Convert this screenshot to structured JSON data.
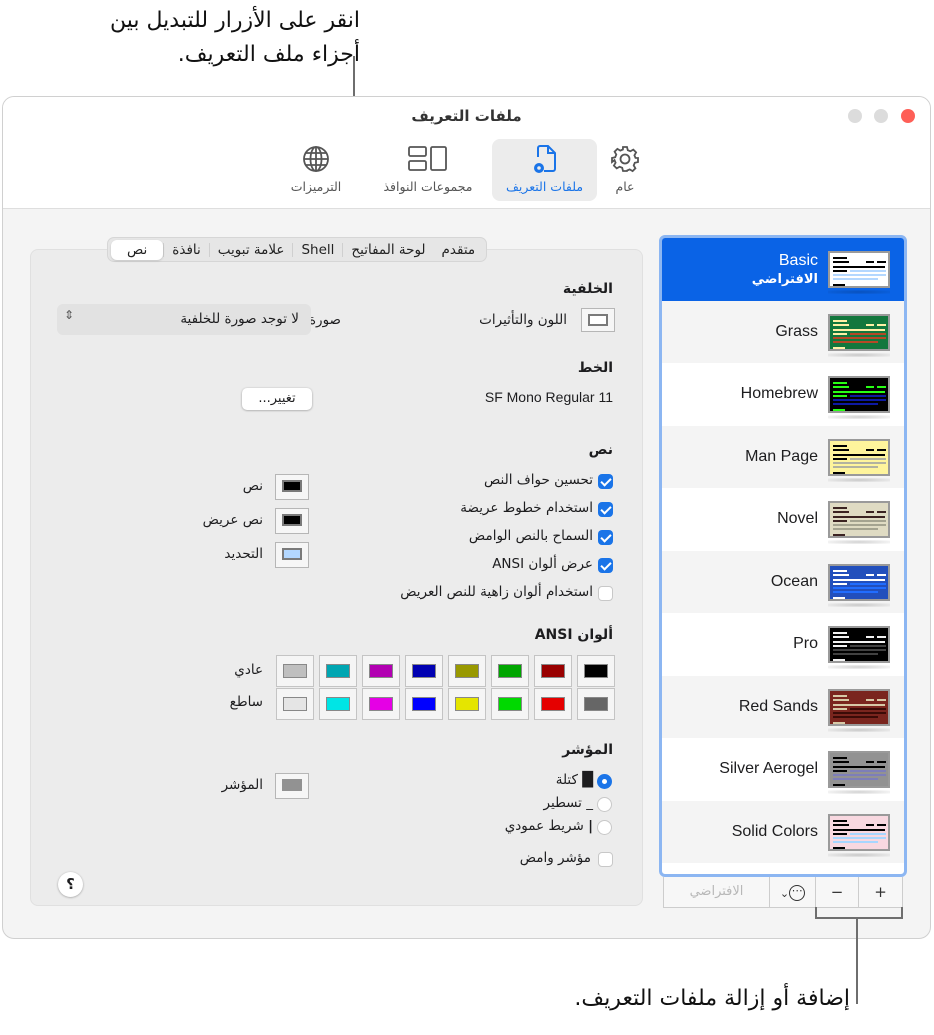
{
  "callouts": {
    "top_line1": "انقر على الأزرار للتبديل بين",
    "top_line2": "أجزاء ملف التعريف.",
    "bottom": "إضافة أو إزالة ملفات التعريف."
  },
  "window": {
    "title": "ملفات التعريف",
    "traffic_colors": {
      "close": "#fe5f57",
      "inactive": "#dcdcdc"
    }
  },
  "toolbar": {
    "items": [
      {
        "id": "general",
        "label": "عام",
        "icon": "gear-icon",
        "active": false
      },
      {
        "id": "profiles",
        "label": "ملفات التعريف",
        "icon": "profile-document-gear-icon",
        "active": true
      },
      {
        "id": "window-groups",
        "label": "مجموعات النوافذ",
        "icon": "window-groups-icon",
        "active": false
      },
      {
        "id": "encodings",
        "label": "الترميزات",
        "icon": "globe-icon",
        "active": false
      }
    ],
    "accent": "#1a74e8"
  },
  "tabs": [
    {
      "label": "نص",
      "selected": true
    },
    {
      "label": "نافذة",
      "selected": false
    },
    {
      "label": "علامة تبويب",
      "selected": false
    },
    {
      "label": "Shell",
      "selected": false
    },
    {
      "label": "لوحة المفاتيح",
      "selected": false
    },
    {
      "label": "متقدم",
      "selected": false
    }
  ],
  "background": {
    "heading": "الخلفية",
    "color_effects_label": "اللون والتأثيرات",
    "color": "#ffffff",
    "image_label": "صورة:",
    "image_value": "لا توجد صورة للخلفية"
  },
  "font": {
    "heading": "الخط",
    "value": "SF Mono Regular 11",
    "change_button": "تغيير..."
  },
  "text": {
    "heading": "نص",
    "checkboxes": [
      {
        "label": "تحسين حواف النص",
        "checked": true
      },
      {
        "label": "استخدام خطوط عريضة",
        "checked": true
      },
      {
        "label": "السماح بالنص الوامض",
        "checked": true
      },
      {
        "label": "عرض ألوان ANSI",
        "checked": true
      },
      {
        "label": "استخدام ألوان زاهية للنص العريض",
        "checked": false
      }
    ],
    "colors": [
      {
        "label": "نص",
        "color": "#000000"
      },
      {
        "label": "نص عريض",
        "color": "#000000"
      },
      {
        "label": "التحديد",
        "color": "#b3d7ff"
      }
    ]
  },
  "ansi": {
    "heading": "ألوان ANSI",
    "normal_label": "عادي",
    "bright_label": "ساطع",
    "normal": [
      "#000000",
      "#990000",
      "#00a600",
      "#999900",
      "#0000b2",
      "#b200b2",
      "#00a6b2",
      "#bfbfbf"
    ],
    "bright": [
      "#666666",
      "#e50000",
      "#00d900",
      "#e5e500",
      "#0000ff",
      "#e500e5",
      "#00e5e5",
      "#e5e5e5"
    ]
  },
  "cursor": {
    "heading": "المؤشر",
    "options": [
      {
        "label": "كتلة",
        "glyph": "█",
        "selected": true
      },
      {
        "label": "تسطير",
        "glyph": "_",
        "selected": false
      },
      {
        "label": "شريط عمودي",
        "glyph": "|",
        "selected": false
      }
    ],
    "blink_label": "مؤشر وامض",
    "blink_checked": false,
    "color_label": "المؤشر",
    "color": "#929292"
  },
  "help_label": "؟",
  "profiles": {
    "items": [
      {
        "name": "Basic",
        "subtitle": "الافتراضي",
        "selected": true,
        "thumb_bg": "#ffffff",
        "thumb_fg": "#000000",
        "thumb_hl": "#b3d7ff"
      },
      {
        "name": "Grass",
        "subtitle": "",
        "selected": false,
        "thumb_bg": "#13773d",
        "thumb_fg": "#fff0a5",
        "thumb_hl": "#b64926"
      },
      {
        "name": "Homebrew",
        "subtitle": "",
        "selected": false,
        "thumb_bg": "#000000",
        "thumb_fg": "#28fe14",
        "thumb_hl": "#0d19a3"
      },
      {
        "name": "Man Page",
        "subtitle": "",
        "selected": false,
        "thumb_bg": "#fef49c",
        "thumb_fg": "#000000",
        "thumb_hl": "#b2b2a0"
      },
      {
        "name": "Novel",
        "subtitle": "",
        "selected": false,
        "thumb_bg": "#dfdbc3",
        "thumb_fg": "#3b2322",
        "thumb_hl": "#a4a390"
      },
      {
        "name": "Ocean",
        "subtitle": "",
        "selected": false,
        "thumb_bg": "#224fbc",
        "thumb_fg": "#ffffff",
        "thumb_hl": "#216dff"
      },
      {
        "name": "Pro",
        "subtitle": "",
        "selected": false,
        "thumb_bg": "#000000",
        "thumb_fg": "#f2f2f2",
        "thumb_hl": "#414141"
      },
      {
        "name": "Red Sands",
        "subtitle": "",
        "selected": false,
        "thumb_bg": "#7a251e",
        "thumb_fg": "#d7c9a7",
        "thumb_hl": "#3b0b07"
      },
      {
        "name": "Silver Aerogel",
        "subtitle": "",
        "selected": false,
        "thumb_bg": "#929292",
        "thumb_fg": "#000000",
        "thumb_hl": "#7d7eb9"
      },
      {
        "name": "Solid Colors",
        "subtitle": "",
        "selected": false,
        "thumb_bg": "#f8d8e0",
        "thumb_fg": "#000000",
        "thumb_hl": "#a7d6ff"
      }
    ],
    "add_label": "+",
    "remove_label": "−",
    "more_label": "⋯",
    "default_label": "الافتراضي"
  }
}
